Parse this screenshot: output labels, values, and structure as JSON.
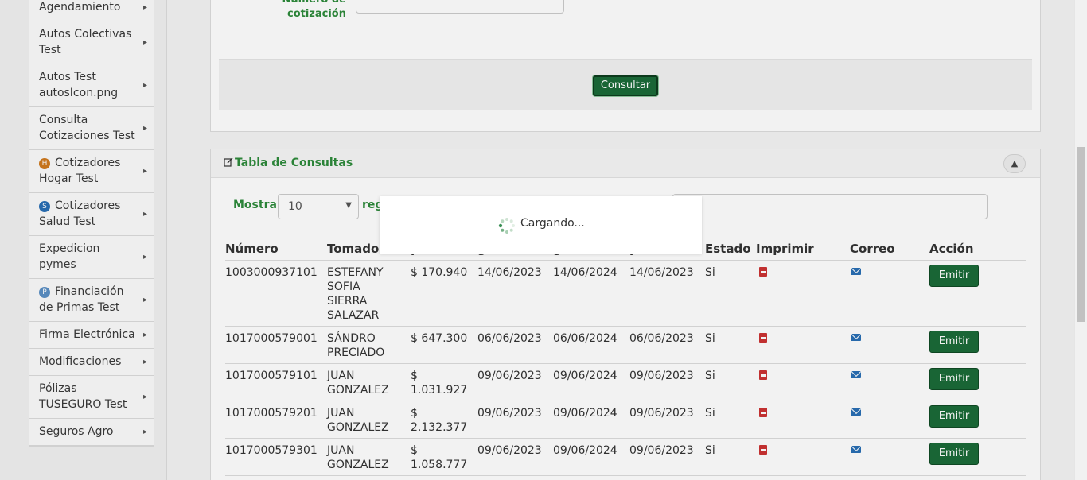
{
  "sidebar": {
    "items": [
      {
        "label": "Agendamiento",
        "badge": null
      },
      {
        "label": "Autos Colectivas Test",
        "badge": null
      },
      {
        "label": "Autos Test autosIcon.png",
        "badge": null
      },
      {
        "label": "Consulta Cotizaciones Test",
        "badge": null
      },
      {
        "label": "Cotizadores Hogar Test",
        "badge": "H",
        "badge_color": "#d07a1e"
      },
      {
        "label": "Cotizadores Salud Test",
        "badge": "S",
        "badge_color": "#2a6fb5"
      },
      {
        "label": "Expedicion pymes",
        "badge": null
      },
      {
        "label": "Financiación de Primas Test",
        "badge": "P",
        "badge_color": "#5a8fc4"
      },
      {
        "label": "Firma Electrónica",
        "badge": null
      },
      {
        "label": "Modificaciones",
        "badge": null
      },
      {
        "label": "Pólizas TUSEGURO Test",
        "badge": null
      },
      {
        "label": "Seguros Agro",
        "badge": null
      }
    ]
  },
  "form": {
    "quote_label": "Número de cotización",
    "quote_value": "",
    "submit_label": "Consultar"
  },
  "table_panel": {
    "title": "Tabla de Consultas",
    "show_label": "Mostrar",
    "page_length": "10",
    "records_label": "reg",
    "search_value": "",
    "columns": [
      "Número",
      "Tomado",
      "p",
      "g",
      "g",
      "p",
      "Estado",
      "Imprimir",
      "Correo",
      "Acción"
    ],
    "rows": [
      {
        "numero": "1003000937101",
        "tomador": "ESTEFANY SOFIA SIERRA SALAZAR",
        "prima": "$ 170.940",
        "d1": "14/06/2023",
        "d2": "14/06/2024",
        "d3": "14/06/2023",
        "estado": "Si",
        "action": "Emitir"
      },
      {
        "numero": "1017000579001",
        "tomador": "SÁNDRO PRECIADO",
        "prima": "$ 647.300",
        "d1": "06/06/2023",
        "d2": "06/06/2024",
        "d3": "06/06/2023",
        "estado": "Si",
        "action": "Emitir"
      },
      {
        "numero": "1017000579101",
        "tomador": "JUAN GONZALEZ",
        "prima": "$ 1.031.927",
        "d1": "09/06/2023",
        "d2": "09/06/2024",
        "d3": "09/06/2023",
        "estado": "Si",
        "action": "Emitir"
      },
      {
        "numero": "1017000579201",
        "tomador": "JUAN GONZALEZ",
        "prima": "$ 2.132.377",
        "d1": "09/06/2023",
        "d2": "09/06/2024",
        "d3": "09/06/2023",
        "estado": "Si",
        "action": "Emitir"
      },
      {
        "numero": "1017000579301",
        "tomador": "JUAN GONZALEZ",
        "prima": "$ 1.058.777",
        "d1": "09/06/2023",
        "d2": "09/06/2024",
        "d3": "09/06/2023",
        "estado": "Si",
        "action": "Emitir"
      }
    ]
  },
  "loading": {
    "text": "Cargando..."
  },
  "colors": {
    "accent": "#2e8b3b",
    "button": "#1b6b38"
  }
}
